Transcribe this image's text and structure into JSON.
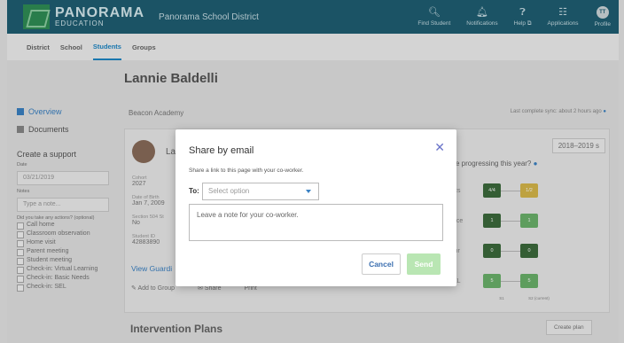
{
  "topbar": {
    "logo_main": "PANORAMA",
    "logo_sub": "EDUCATION",
    "district": "Panorama School District",
    "nav": [
      {
        "label": "Find Student",
        "icon": "search-icon"
      },
      {
        "label": "Notifications",
        "icon": "bell-icon"
      },
      {
        "label": "Help ⧉",
        "icon": "help-icon"
      },
      {
        "label": "Applications",
        "icon": "grid-icon"
      },
      {
        "label": "Profile",
        "icon": "profile-icon",
        "initials": "TT"
      }
    ]
  },
  "subnav": {
    "district": "District",
    "school": "School",
    "students": "Students",
    "groups": "Groups"
  },
  "student": {
    "name": "Lannie Baldelli"
  },
  "sidebar": {
    "overview": "Overview",
    "documents": "Documents",
    "create_support": "Create a support",
    "date_label": "Date",
    "date_value": "03/21/2019",
    "notes_label": "Notes",
    "notes_placeholder": "Type a note...",
    "actions_question": "Did you take any actions? (optional)",
    "actions": [
      "Call home",
      "Classroom observation",
      "Home visit",
      "Parent meeting",
      "Student meeting",
      "Check-in: Virtual Learning",
      "Check-in: Basic Needs",
      "Check-in: SEL"
    ]
  },
  "main": {
    "school": "Beacon Academy",
    "sync": "Last complete sync: about 2 hours ago",
    "card_name": "La",
    "cohort_label": "Cohort",
    "cohort_value": "2027",
    "dob_label": "Date of Birth",
    "dob_value": "Jan 7, 2009",
    "section504_label": "Section 504 St",
    "section504_value": "No",
    "student_id_label": "Student ID",
    "student_id_value": "42883890",
    "view_guardians": "View Guardi",
    "add_to_group": "Add to Group",
    "share": "Share",
    "print": "Print",
    "year": "2018–2019 s",
    "progress_question": "e progressing this year?",
    "rows": [
      {
        "label": "ics",
        "s1": "4/4",
        "s2": "1/2",
        "c1": "#3d6b3d",
        "c2": "#d9b94a"
      },
      {
        "label": "nce",
        "s1": "1",
        "s2": "1",
        "c1": "#3d6b3d",
        "c2": "#6bb36b"
      },
      {
        "label": "ior",
        "s1": "0",
        "s2": "0",
        "c1": "#3d6b3d",
        "c2": "#3d6b3d"
      },
      {
        "label": "EL",
        "s1": "5",
        "s2": "5",
        "c1": "#6bb36b",
        "c2": "#6bb36b"
      }
    ],
    "col1": "S1",
    "col2": "S2 (current)",
    "intervention_plans": "Intervention Plans",
    "create_plan": "Create plan"
  },
  "modal": {
    "title": "Share by email",
    "description": "Share a link to this page with your co-worker.",
    "to_label": "To:",
    "select_placeholder": "Select option",
    "note_placeholder": "Leave a note for your co-worker.",
    "cancel": "Cancel",
    "send": "Send"
  }
}
